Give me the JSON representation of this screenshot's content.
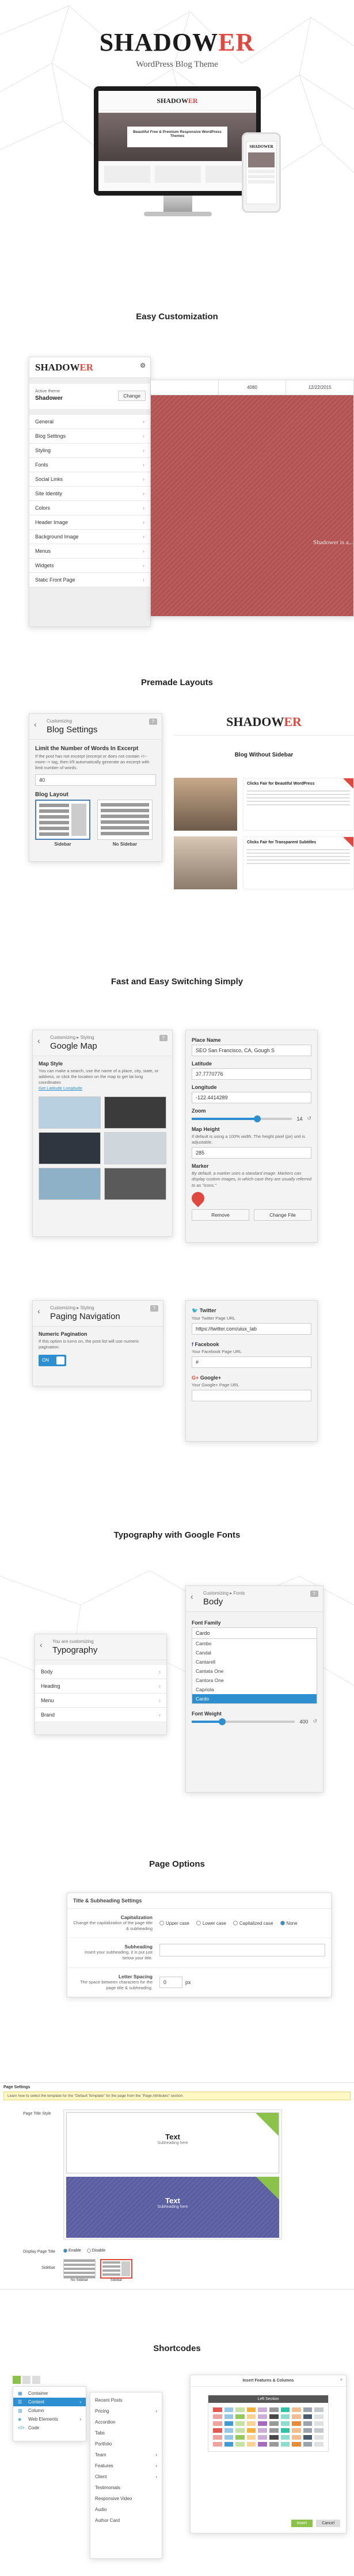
{
  "hero": {
    "brand_main": "SHADOW",
    "brand_accent": "ER",
    "tagline": "WordPress Blog Theme",
    "screen_title": "Beautiful Free & Premium Responsive WordPress Themes",
    "phone_brand": "SHADOWER"
  },
  "sections": {
    "easy_customization": "Easy Customization",
    "premade_layouts": "Premade Layouts",
    "fast_switching": "Fast and Easy Switching Simply",
    "typography": "Typography with Google Fonts",
    "page_options": "Page Options",
    "shortcodes": "Shortcodes"
  },
  "customizer": {
    "logo_main": "SHADOW",
    "logo_accent": "ER",
    "active_theme_label": "Active theme",
    "active_theme_name": "Shadower",
    "change_label": "Change",
    "items": [
      "General",
      "Blog Settings",
      "Styling",
      "Fonts",
      "Social Links",
      "Site Identity",
      "Colors",
      "Header Image",
      "Background Image",
      "Menus",
      "Widgets",
      "Static Front Page"
    ],
    "preview_col1": "",
    "preview_col2": "4080",
    "preview_col3": "12/22/2015",
    "preview_overlay_text": "Shadower is a..."
  },
  "blog_settings": {
    "crumb": "Customizing",
    "title": "Blog Settings",
    "help": "",
    "excerpt_label": "Limit the Number of Words In Excerpt",
    "excerpt_help": "If the post has not excerpt (excerpt or does not contain <!--more--> tag, then it'll automatically generate an excerpt with limit number of words.",
    "excerpt_value": "40",
    "layout_label": "Blog Layout",
    "layout_options": [
      "Sidebar",
      "No Sidebar"
    ]
  },
  "layout_preview": {
    "brand_main": "SHADOW",
    "brand_accent": "ER",
    "heading": "Blog Without Sidebar",
    "post1_title": "Clicks Fair for Beautiful WordPress",
    "post2_title": "Clicks Fair for Transparent Subtitles"
  },
  "google_map": {
    "crumb": "Customizing ▸ Styling",
    "title": "Google Map",
    "style_label": "Map Style",
    "style_help": "You can make a search, use the name of a place, city, state, or address, or click the location on the map to get lat long coordinates",
    "style_link": "Get Latitude Longitude",
    "place_label": "Place Name",
    "place_value": "SEO San Francisco, CA, Gough S",
    "lat_label": "Latitude",
    "lat_value": "37.7770776",
    "lng_label": "Longitude",
    "lng_value": "-122.4414289",
    "zoom_label": "Zoom",
    "zoom_value": "14",
    "height_label": "Map Height",
    "height_help": "If default is using a 100% width. The height pixel (px) unit is adjustable.",
    "height_value": "285",
    "marker_label": "Marker",
    "marker_help": "By default, a marker uses a standard image. Markers can display custom images, in which case they are usually referred to as \"icons.\"",
    "remove_label": "Remove",
    "change_file_label": "Change File"
  },
  "paging": {
    "crumb": "Customizing ▸ Styling",
    "title": "Paging Navigation",
    "numeric_label": "Numeric Pagination",
    "numeric_help": "If this option is turns on, the post list will use numeric pagination.",
    "toggle_on": "ON"
  },
  "social": {
    "twitter_label": "Twitter",
    "twitter_help": "Your Twitter Page URL",
    "twitter_value": "https://twitter.com/uiux_lab",
    "facebook_label": "Facebook",
    "facebook_help": "Your Facebook Page URL",
    "facebook_value": "#",
    "google_label": "Google+",
    "google_help": "Your Google+ Page URL"
  },
  "fonts_panel": {
    "crumb": "You are customizing",
    "title": "Typography",
    "items": [
      "Body",
      "Heading",
      "Menu",
      "Brand"
    ]
  },
  "body_font": {
    "crumb": "Customizing ▸ Fonts",
    "title": "Body",
    "family_label": "Font Family",
    "family_value": "Cardo",
    "options": [
      "Cambo",
      "Candal",
      "Cantarell",
      "Cantata One",
      "Cantora One",
      "Capriola",
      "Cardo"
    ],
    "weight_label": "Font Weight",
    "weight_value": "400"
  },
  "title_settings": {
    "header": "Title & Subheading Settings",
    "cap_label": "Capitalization",
    "cap_help": "Change the capitalization of the page title & subheading",
    "cap_options": [
      "Upper case",
      "Lower case",
      "Capitalized case",
      "None"
    ],
    "cap_selected": "None",
    "sub_label": "Subheading",
    "sub_help": "Insert your subheading, it is put just below your title.",
    "spacing_label": "Letter Spacing",
    "spacing_help": "The space between characters for the page title & subheading.",
    "spacing_value": "0",
    "spacing_unit": "px"
  },
  "page_settings": {
    "header": "Page Settings",
    "notice": "Learn how to select the template for the \"Default Template\" for the page from the \"Page Attributes\" section.",
    "style_label": "Page Title Style",
    "preview_title": "Text",
    "preview_sub": "Subheading here",
    "display_label": "Display Page Title",
    "display_options": [
      "Enable",
      "Disable"
    ],
    "sidebar_label": "Sidebar",
    "sidebar_options": [
      "No Sidebar",
      "Sidebar"
    ]
  },
  "shortcodes": {
    "menu_items": [
      "Container",
      "Content",
      "Column",
      "Web Elements",
      "Code"
    ],
    "submenu": [
      "Recent Posts",
      "Pricing",
      "Accordion",
      "Tabs",
      "Portfolio",
      "Team",
      "Features",
      "Client",
      "Testimonials",
      "Responsive Video",
      "Audio",
      "Author Card"
    ],
    "dialog_title": "Insert Features & Columns",
    "dialog_inner_title": "Left Section",
    "insert_label": "Insert",
    "cancel_label": "Cancel"
  },
  "colors": {
    "accent": "#e0473f",
    "wp_blue": "#2e8fd0",
    "preview_red": "#b55656",
    "preview_blue": "#5d61a3"
  }
}
